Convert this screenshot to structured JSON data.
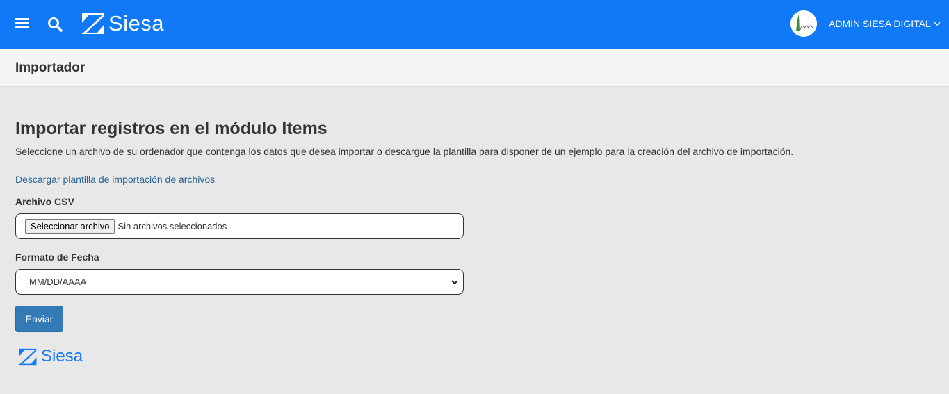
{
  "brand": {
    "name": "Siesa",
    "accent": "#1079f7"
  },
  "topbar": {
    "menu_icon": "hamburger-icon",
    "search_icon": "search-icon",
    "user_name": "ADMIN SIESA DIGITAL"
  },
  "subheader": {
    "title": "Importador"
  },
  "main": {
    "title": "Importar registros en el módulo Items",
    "description": "Seleccione un archivo de su ordenador que contenga los datos que desea importar o descargue la plantilla para disponer de un ejemplo para la creación del archivo de importación.",
    "download_link": "Descargar plantilla de importación de archivos",
    "file_label": "Archivo CSV",
    "file_button": "Seleccionar archivo",
    "file_status": "Sin archivos seleccionados",
    "date_label": "Formato de Fecha",
    "date_value": "MM/DD/AAAA",
    "submit": "Enviar"
  },
  "footer": {
    "brand": "Siesa"
  }
}
